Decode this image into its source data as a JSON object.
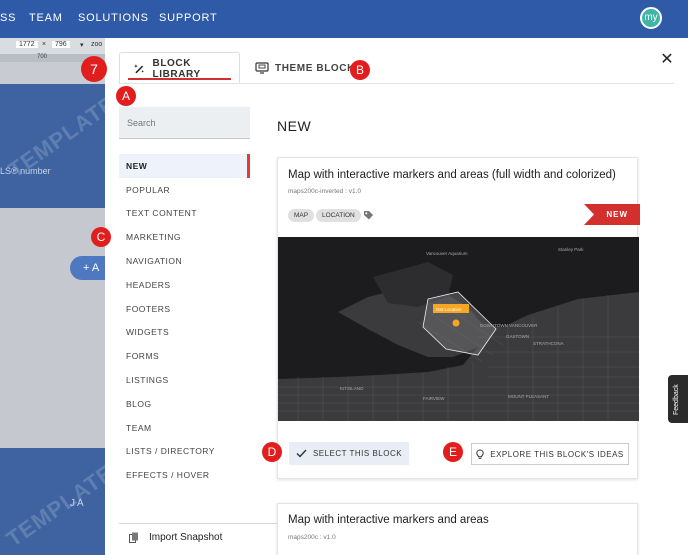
{
  "topnav": {
    "items": [
      "SS",
      "TEAM",
      "SOLUTIONS",
      "SUPPORT"
    ],
    "avatar_text": "my"
  },
  "background": {
    "width_value": "1772",
    "height_value": "796",
    "zoom_label": "zoo",
    "ruler_mark": "700",
    "watermark": "TEMPLATE",
    "field_hint": "LS® number",
    "button_fragment": "+ A",
    "footer_fragment": "JA"
  },
  "modal": {
    "tabs": [
      {
        "label": "BLOCK LIBRARY",
        "icon": "magic-wand-icon",
        "active": true
      },
      {
        "label": "THEME BLOCKS",
        "icon": "monitor-icon",
        "active": false
      }
    ],
    "close_icon": "close-icon"
  },
  "sidebar": {
    "search_placeholder": "Search",
    "categories": [
      "NEW",
      "POPULAR",
      "TEXT CONTENT",
      "MARKETING",
      "NAVIGATION",
      "HEADERS",
      "FOOTERS",
      "WIDGETS",
      "FORMS",
      "LISTINGS",
      "BLOG",
      "TEAM",
      "LISTS / DIRECTORY",
      "EFFECTS / HOVER"
    ],
    "active_category": "NEW",
    "import_label": "Import Snapshot"
  },
  "main": {
    "section_title": "NEW",
    "cards": [
      {
        "title": "Map with interactive markers and areas (full width and colorized)",
        "version": "maps200c-inverted : v1.0",
        "tags": [
          "MAP",
          "LOCATION"
        ],
        "badge": "NEW",
        "map_labels": [
          "Stanley Park",
          "Vancouver Aquarium",
          "Get Location",
          "DOWNTOWN VANCOUVER",
          "GASTOWN",
          "STRATHCONA",
          "KITSILANO",
          "FAIRVIEW",
          "MOUNT PLEASANT"
        ],
        "select_label": "SELECT THIS BLOCK",
        "ideas_label": "EXPLORE THIS BLOCK'S IDEAS"
      },
      {
        "title": "Map with interactive markers and areas",
        "version": "maps200c : v1.0"
      }
    ]
  },
  "markers": [
    "7",
    "A",
    "B",
    "C",
    "D",
    "E"
  ],
  "feedback_label": "Feedback",
  "colors": {
    "topnav": "#2f5aa8",
    "accent_red": "#d32f2f",
    "marker_red": "#e21d1d",
    "active_bg": "#eef2fb"
  }
}
